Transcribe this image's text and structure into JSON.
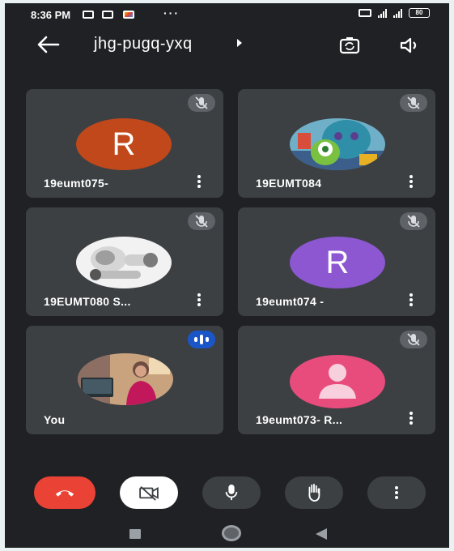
{
  "status_bar": {
    "time": "8:36 PM",
    "overflow": "···",
    "battery": "80"
  },
  "header": {
    "meeting_code": "jhg-pugq-yxq"
  },
  "colors": {
    "background": "#202124",
    "tile": "#3c4043",
    "end_call": "#ea4335",
    "avatar_orange": "#c0481a",
    "avatar_purple": "#8c57d0",
    "avatar_pink": "#e84c7d",
    "speaking": "#1a56c7"
  },
  "participants": [
    {
      "name": "19eumt075-",
      "avatar_letter": "R",
      "avatar": "letter",
      "muted": true
    },
    {
      "name": "19EUMT084",
      "avatar": "photo-cartoon-monsters",
      "muted": true
    },
    {
      "name": "19EUMT080 S...",
      "avatar": "photo-robot",
      "muted": true
    },
    {
      "name": "19eumt074 -",
      "avatar_letter": "R",
      "avatar": "letter",
      "muted": true
    },
    {
      "name": "You",
      "avatar": "photo-person",
      "muted": false,
      "speaking": true
    },
    {
      "name": "19eumt073- R...",
      "avatar": "generic-person-icon",
      "muted": true
    }
  ],
  "controls": [
    "end-call-icon",
    "camera-off-icon",
    "microphone-icon",
    "raise-hand-icon",
    "more-options-icon"
  ],
  "nav": [
    "recent-apps-icon",
    "home-icon",
    "back-nav-icon"
  ]
}
